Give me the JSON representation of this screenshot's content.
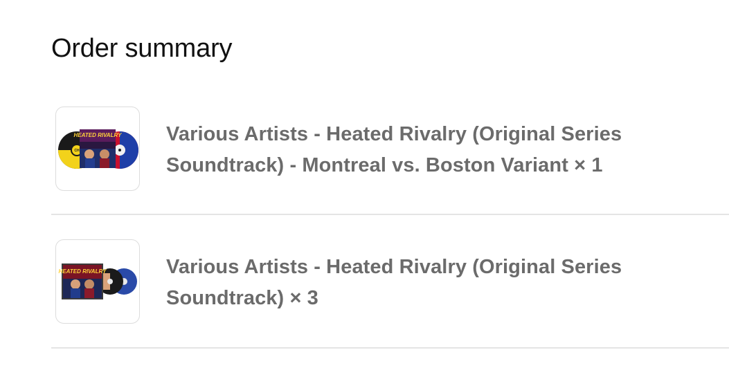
{
  "order_summary": {
    "title": "Order summary",
    "items": [
      {
        "name": "Various Artists - Heated Rivalry (Original Series Soundtrack) - Montreal vs. Boston Variant",
        "quantity": "× 1",
        "thumbnail": {
          "icon": "vinyl-album-image",
          "cover_text": "HEATED RIVALRY",
          "colors": [
            "#f2d21b",
            "#1a1a1a",
            "#c8102e",
            "#1e3fa8"
          ]
        }
      },
      {
        "name": "Various Artists - Heated Rivalry (Original Series Soundtrack)",
        "quantity": "× 3",
        "thumbnail": {
          "icon": "cd-bundle-image",
          "cover_text": "HEATED RIVALRY",
          "colors": [
            "#8b1e2b",
            "#1a1a1a",
            "#2a4aa8"
          ]
        }
      }
    ]
  }
}
